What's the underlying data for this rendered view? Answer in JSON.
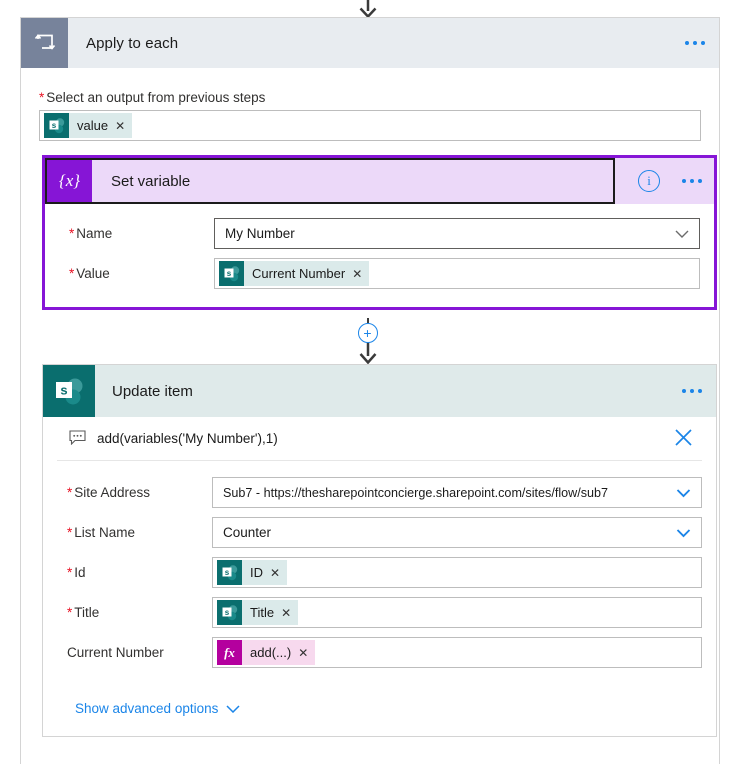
{
  "connectors": {
    "top_arrow_icon": "arrow-down-icon",
    "insert_button_label": "+",
    "insert_button_icon": "plus-circle-icon"
  },
  "loop_card": {
    "icon": "apply-to-each-loop-icon",
    "title": "Apply to each",
    "menu_icon": "ellipsis-icon",
    "field": {
      "label": "Select an output from previous steps",
      "required": true,
      "token": {
        "icon": "sharepoint-icon",
        "text": "value",
        "remove_icon": "remove-token-icon"
      }
    }
  },
  "set_variable_card": {
    "icon": "set-variable-braces-icon",
    "icon_glyph": "{x}",
    "title": "Set variable",
    "info_icon": "info-circle-icon",
    "info_glyph": "i",
    "menu_icon": "ellipsis-icon",
    "selected": true,
    "accent_color": "#8615d6",
    "fields": [
      {
        "label": "Name",
        "required": true,
        "type": "dropdown",
        "value": "My Number",
        "chevron_icon": "chevron-down-icon"
      },
      {
        "label": "Value",
        "required": true,
        "type": "token",
        "token": {
          "icon": "sharepoint-icon",
          "text": "Current Number",
          "remove_icon": "remove-token-icon"
        }
      }
    ]
  },
  "update_item_card": {
    "icon": "sharepoint-icon",
    "title": "Update item",
    "menu_icon": "ellipsis-icon",
    "accent_color": "#0a6e6e",
    "comment": {
      "icon": "comment-icon",
      "text": "add(variables('My Number'),1)",
      "close_icon": "close-icon"
    },
    "fields": [
      {
        "label": "Site Address",
        "required": true,
        "type": "dropdown",
        "value": "Sub7 - https://thesharepointconcierge.sharepoint.com/sites/flow/sub7",
        "chevron_icon": "chevron-down-icon"
      },
      {
        "label": "List Name",
        "required": true,
        "type": "dropdown",
        "value": "Counter",
        "chevron_icon": "chevron-down-icon"
      },
      {
        "label": "Id",
        "required": true,
        "type": "token",
        "token": {
          "icon": "sharepoint-icon",
          "text": "ID",
          "remove_icon": "remove-token-icon"
        }
      },
      {
        "label": "Title",
        "required": true,
        "type": "token",
        "token": {
          "icon": "sharepoint-icon",
          "text": "Title",
          "remove_icon": "remove-token-icon"
        }
      },
      {
        "label": "Current Number",
        "required": false,
        "type": "function-token",
        "token": {
          "icon": "function-fx-icon",
          "icon_glyph": "fx",
          "text": "add(...)",
          "remove_icon": "remove-token-icon"
        }
      }
    ],
    "advanced_link": {
      "label": "Show advanced options",
      "chevron_icon": "chevron-down-icon"
    }
  }
}
